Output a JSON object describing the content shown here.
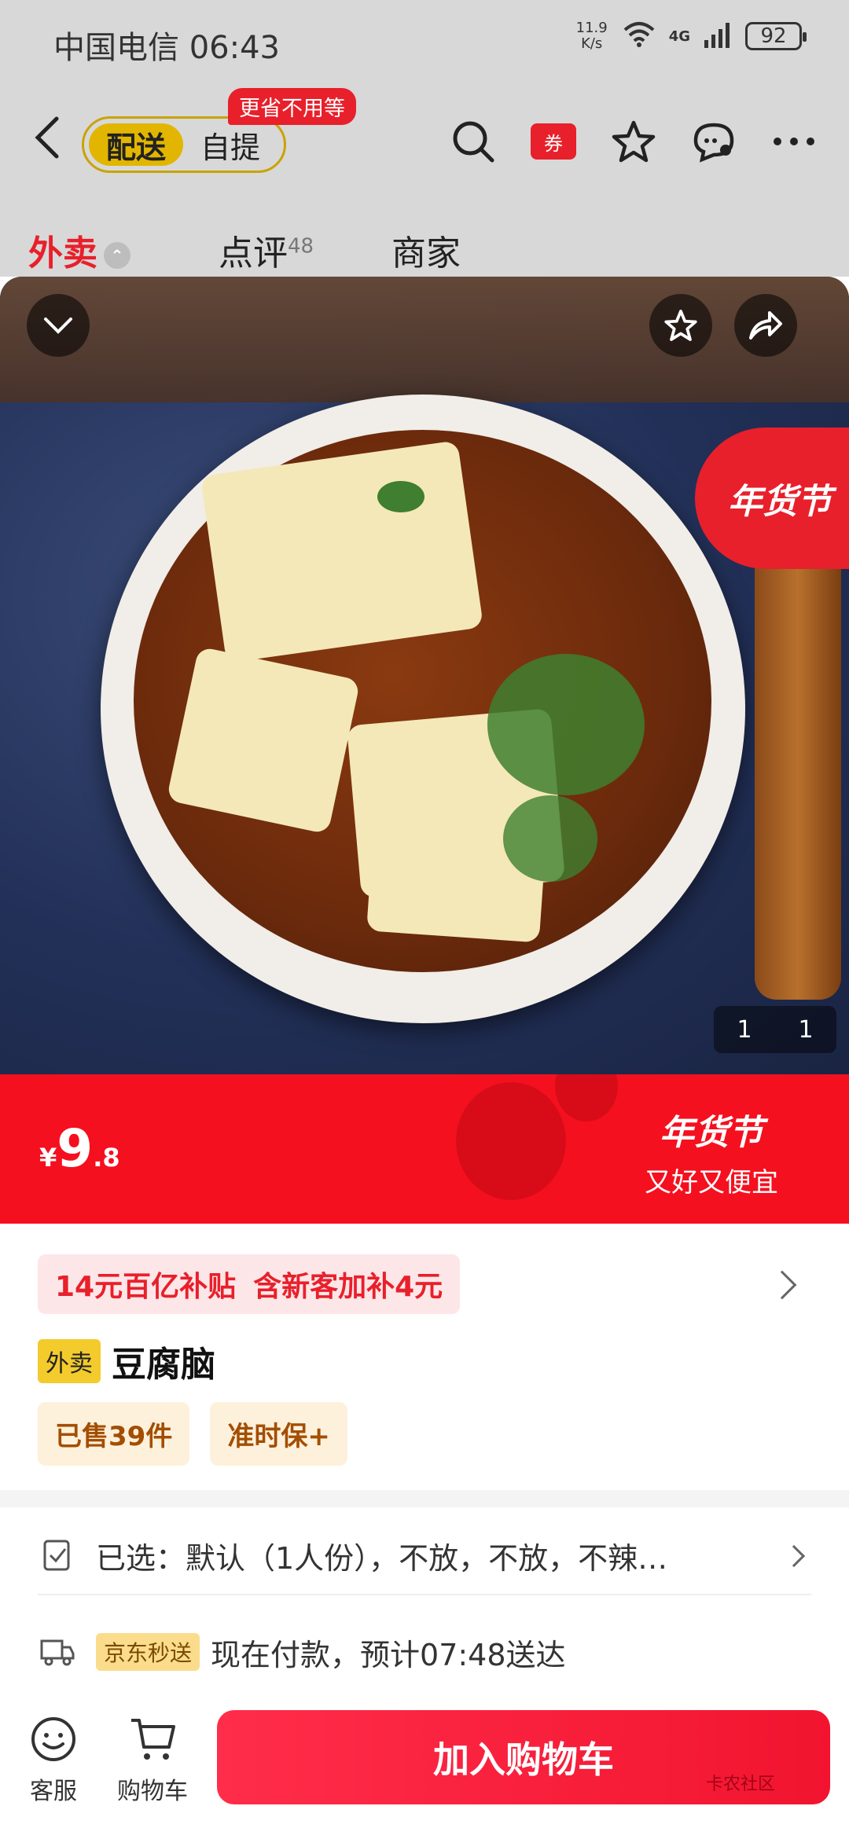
{
  "status_bar": {
    "carrier_time": "中国电信 06:43",
    "net_speed_value": "11.9",
    "net_speed_unit": "K/s",
    "network": "4G",
    "battery": "92"
  },
  "nav": {
    "mode_active": "配送",
    "mode_other": "自提",
    "mode_tag": "更省不用等",
    "coupon_label": "券"
  },
  "tabs": [
    {
      "label": "外卖"
    },
    {
      "label": "点评",
      "count": "48"
    },
    {
      "label": "商家"
    }
  ],
  "hero": {
    "festival_badge": "年货节",
    "counter_current": "1",
    "counter_total": "1"
  },
  "price_banner": {
    "currency": "¥",
    "price_int": "9",
    "price_dec": ".8",
    "title": "年货节",
    "subtitle": "又好又便宜"
  },
  "product": {
    "subsidy_1": "14元百亿补贴",
    "subsidy_2": "含新客加补4元",
    "tag": "外卖",
    "title": "豆腐脑",
    "badges": [
      "已售39件",
      "准时保+"
    ],
    "spec": "已选：默认（1人份），不放，不放，不辣…",
    "jd_tag": "京东秒送",
    "delivery": "现在付款，预计07:48送达"
  },
  "bottom_bar": {
    "service_label": "客服",
    "cart_label": "购物车",
    "add_to_cart": "加入购物车",
    "watermark": "卡农社区"
  },
  "colors": {
    "brand_red": "#f5101f",
    "accent_yellow": "#e2b600",
    "subsidy_bg": "#fde6e8"
  }
}
